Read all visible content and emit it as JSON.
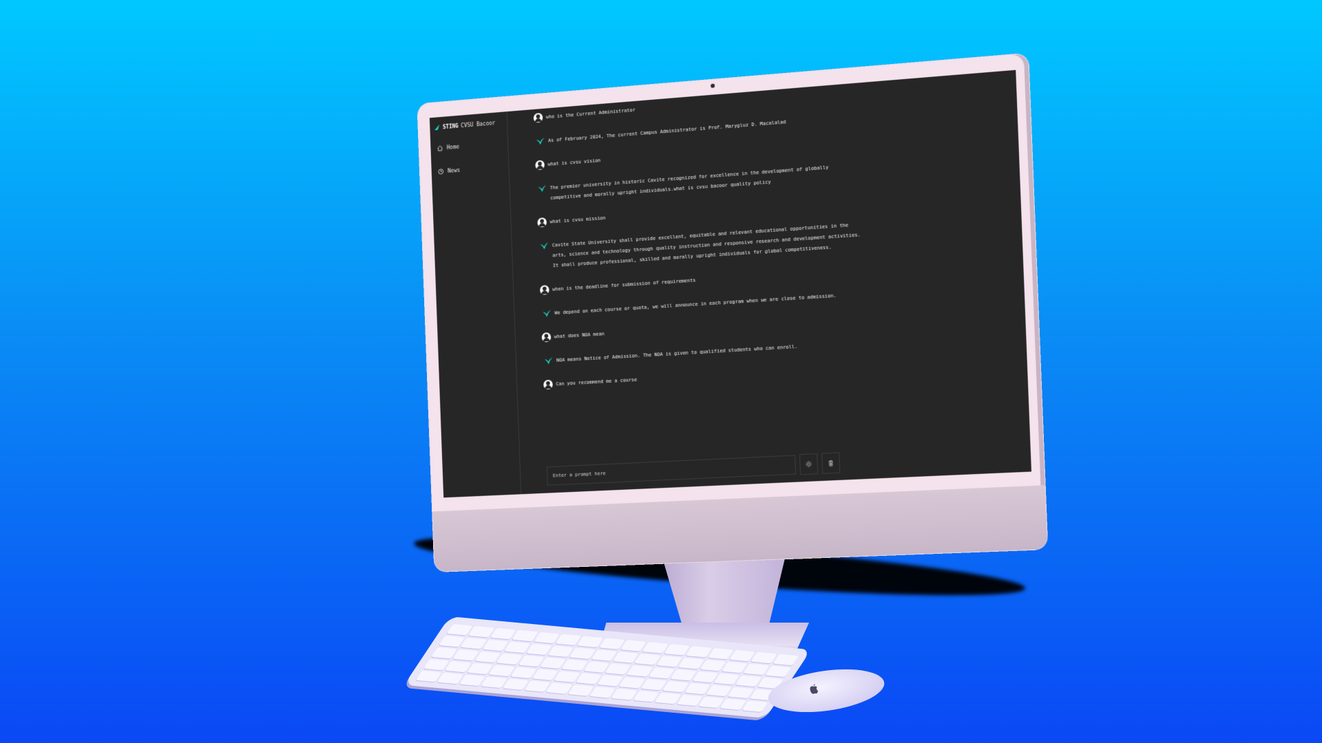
{
  "app": {
    "brand_bold": "STING",
    "brand_rest": "CVSU Bacoor"
  },
  "sidebar": {
    "items": [
      {
        "label": "Home",
        "icon": "home-icon"
      },
      {
        "label": "News",
        "icon": "clock-icon"
      }
    ]
  },
  "chat": {
    "messages": [
      {
        "role": "user",
        "text": "who is the Current Administrator"
      },
      {
        "role": "bot",
        "text": "As of February 2024, The current Campus Administrator is Prof. Marygluz D. Macalalad"
      },
      {
        "role": "user",
        "text": "what is cvsu vision"
      },
      {
        "role": "bot",
        "text": "The premier university in historic Cavite recognized for excellence in the development of globally competitive and morally upright individuals.what is cvsu bacoor quality policy"
      },
      {
        "role": "user",
        "text": "what is cvsu mission"
      },
      {
        "role": "bot",
        "text": "Cavite State University shall provide excellent, equitable and relevant educational opportunities in the arts, science and technology through quality instruction and responsive research and development activities. It shall produce professional, skilled and morally upright individuals for global competitiveness."
      },
      {
        "role": "user",
        "text": "when is the deadline for submission of requirements"
      },
      {
        "role": "bot",
        "text": "We depend on each course or quota, we will announce in each program when we are close to admission."
      },
      {
        "role": "user",
        "text": "what does NOA mean"
      },
      {
        "role": "bot",
        "text": "NOA means Notice of Admission. The NOA is given to qualified students who can enroll."
      },
      {
        "role": "user",
        "text": "Can you recommend me a course"
      }
    ]
  },
  "input": {
    "placeholder": "Enter a prompt here"
  },
  "colors": {
    "accent": "#18d4c8",
    "screen_bg": "#262626",
    "bezel": "#f4e2ec"
  }
}
